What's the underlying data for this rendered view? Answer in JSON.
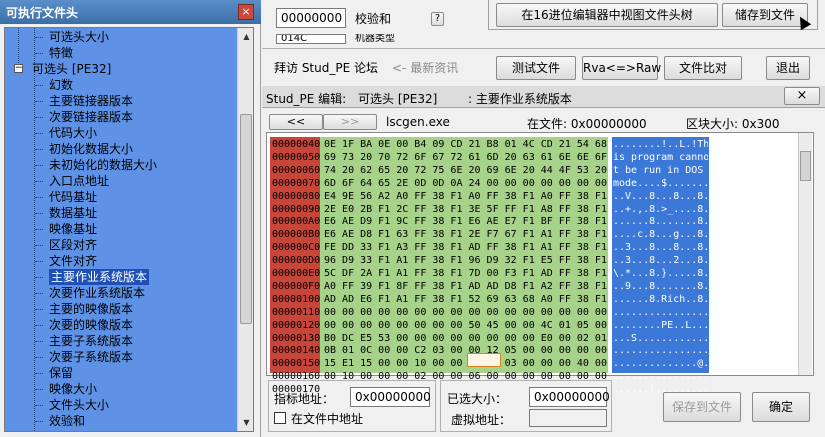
{
  "tree": {
    "title": "可执行文件头",
    "close": "×",
    "items": [
      {
        "label": "可选头大小",
        "indent": 2,
        "selected": false
      },
      {
        "label": "特徵",
        "indent": 2,
        "selected": false
      },
      {
        "label": "可选头 [PE32]",
        "indent": 1,
        "selected": false,
        "expander": "−"
      },
      {
        "label": "幻数",
        "indent": 2,
        "selected": false
      },
      {
        "label": "主要链接器版本",
        "indent": 2,
        "selected": false
      },
      {
        "label": "次要链接器版本",
        "indent": 2,
        "selected": false
      },
      {
        "label": "代码大小",
        "indent": 2,
        "selected": false
      },
      {
        "label": "初始化数据大小",
        "indent": 2,
        "selected": false
      },
      {
        "label": "未初始化的数据大小",
        "indent": 2,
        "selected": false
      },
      {
        "label": "入口点地址",
        "indent": 2,
        "selected": false
      },
      {
        "label": "代码基址",
        "indent": 2,
        "selected": false
      },
      {
        "label": "数据基址",
        "indent": 2,
        "selected": false
      },
      {
        "label": "映像基址",
        "indent": 2,
        "selected": false
      },
      {
        "label": "区段对齐",
        "indent": 2,
        "selected": false
      },
      {
        "label": "文件对齐",
        "indent": 2,
        "selected": false
      },
      {
        "label": "主要作业系统版本",
        "indent": 2,
        "selected": true
      },
      {
        "label": "次要作业系统版本",
        "indent": 2,
        "selected": false
      },
      {
        "label": "主要的映像版本",
        "indent": 2,
        "selected": false
      },
      {
        "label": "次要的映像版本",
        "indent": 2,
        "selected": false
      },
      {
        "label": "主要子系统版本",
        "indent": 2,
        "selected": false
      },
      {
        "label": "次要子系统版本",
        "indent": 2,
        "selected": false
      },
      {
        "label": "保留",
        "indent": 2,
        "selected": false
      },
      {
        "label": "映像大小",
        "indent": 2,
        "selected": false
      },
      {
        "label": "文件头大小",
        "indent": 2,
        "selected": false
      },
      {
        "label": "效验和",
        "indent": 2,
        "selected": false
      }
    ]
  },
  "top": {
    "checksum_value": "00000000",
    "checksum_label": "校验和",
    "help": "?",
    "partial_value": "014C",
    "partial_label": "机器类型",
    "view_hex_button": "在16进位编辑器中视图文件头树",
    "save_button": "储存到文件",
    "visit_label": "拜访 Stud_PE 论坛",
    "news_label": "<- 最新资讯",
    "test_button": "测试文件",
    "rva_button": "Rva<=>Raw",
    "compare_button": "文件比对",
    "exit_button": "退出"
  },
  "hex": {
    "title": "Stud_PE 编辑:",
    "field_name": "可选头 [PE32]",
    "field_desc": ": 主要作业系统版本",
    "close": "×",
    "nav_prev": "<<",
    "nav_next": ">>",
    "filename": "lscgen.exe",
    "infile_label": "在文件: 0x00000000",
    "blocksize_label": "区块大小: 0x300",
    "rows": [
      {
        "addr": "00000040",
        "hex": "0E 1F BA 0E 00 B4 09 CD 21 B8 01 4C CD 21 54 68",
        "ascii": "........!..L.!Th"
      },
      {
        "addr": "00000050",
        "hex": "69 73 20 70 72 6F 67 72 61 6D 20 63 61 6E 6E 6F",
        "ascii": "is program canno"
      },
      {
        "addr": "00000060",
        "hex": "74 20 62 65 20 72 75 6E 20 69 6E 20 44 4F 53 20",
        "ascii": "t be run in DOS "
      },
      {
        "addr": "00000070",
        "hex": "6D 6F 64 65 2E 0D 0D 0A 24 00 00 00 00 00 00 00",
        "ascii": "mode....$......."
      },
      {
        "addr": "00000080",
        "hex": "E4 9E 56 A2 A0 FF 38 F1 A0 FF 38 F1 A0 FF 38 F1",
        "ascii": "..V...8...8...8."
      },
      {
        "addr": "00000090",
        "hex": "2E E0 2B F1 2C FF 38 F1 3E 5F FF F1 A8 FF 38 F1",
        "ascii": "..+.,.8.>_....8."
      },
      {
        "addr": "000000A0",
        "hex": "E6 AE D9 F1 9C FF 38 F1 E6 AE E7 F1 BF FF 38 F1",
        "ascii": "......8.......8."
      },
      {
        "addr": "000000B0",
        "hex": "E6 AE D8 F1 63 FF 38 F1 2E F7 67 F1 A1 FF 38 F1",
        "ascii": "....c.8...g...8."
      },
      {
        "addr": "000000C0",
        "hex": "FE DD 33 F1 A3 FF 38 F1 AD FF 38 F1 A1 FF 38 F1",
        "ascii": "..3...8...8...8."
      },
      {
        "addr": "000000D0",
        "hex": "96 D9 33 F1 A1 FF 38 F1 96 D9 32 F1 E5 FF 38 F1",
        "ascii": "..3...8...2...8."
      },
      {
        "addr": "000000E0",
        "hex": "5C DF 2A F1 A1 FF 38 F1 7D 00 F3 F1 AD FF 38 F1",
        "ascii": "\\.*...8.}.....8."
      },
      {
        "addr": "000000F0",
        "hex": "A0 FF 39 F1 8F FF 38 F1 AD AD D8 F1 A2 FF 38 F1",
        "ascii": "..9...8.......8."
      },
      {
        "addr": "00000100",
        "hex": "AD AD E6 F1 A1 FF 38 F1 52 69 63 68 A0 FF 38 F1",
        "ascii": "......8.Rich..8."
      },
      {
        "addr": "00000110",
        "hex": "00 00 00 00 00 00 00 00 00 00 00 00 00 00 00 00",
        "ascii": "................"
      },
      {
        "addr": "00000120",
        "hex": "00 00 00 00 00 00 00 00 50 45 00 00 4C 01 05 00",
        "ascii": "........PE..L..."
      },
      {
        "addr": "00000130",
        "hex": "B0 DC E5 53 00 00 00 00 00 00 00 00 E0 00 02 01",
        "ascii": "...S............"
      },
      {
        "addr": "00000140",
        "hex": "0B 01 0C 00 00 C2 03 00 00 12 05 00 00 00 00 00",
        "ascii": "................"
      },
      {
        "addr": "00000150",
        "hex": "15 E1 15 00 00 10 00 00 00 E0 03 00 00 00 40 00",
        "ascii": "..............@."
      },
      {
        "addr": "00000160",
        "hex": "00 10 00 00 00 02 00 00 06 00 00 00 00 00 00 00",
        "ascii": "................"
      },
      {
        "addr": "00000170",
        "hex": "                                                ",
        "ascii": "......(........."
      }
    ],
    "pointer_label": "指标地址：",
    "pointer_value": "0x00000000",
    "locate_label": "在文件中地址",
    "selsize_label": "已选大小：",
    "selsize_value": "0x00000000",
    "virt_label": "虚拟地址：",
    "virt_value": "",
    "save_button": "保存到文件",
    "ok_button": "确定"
  }
}
